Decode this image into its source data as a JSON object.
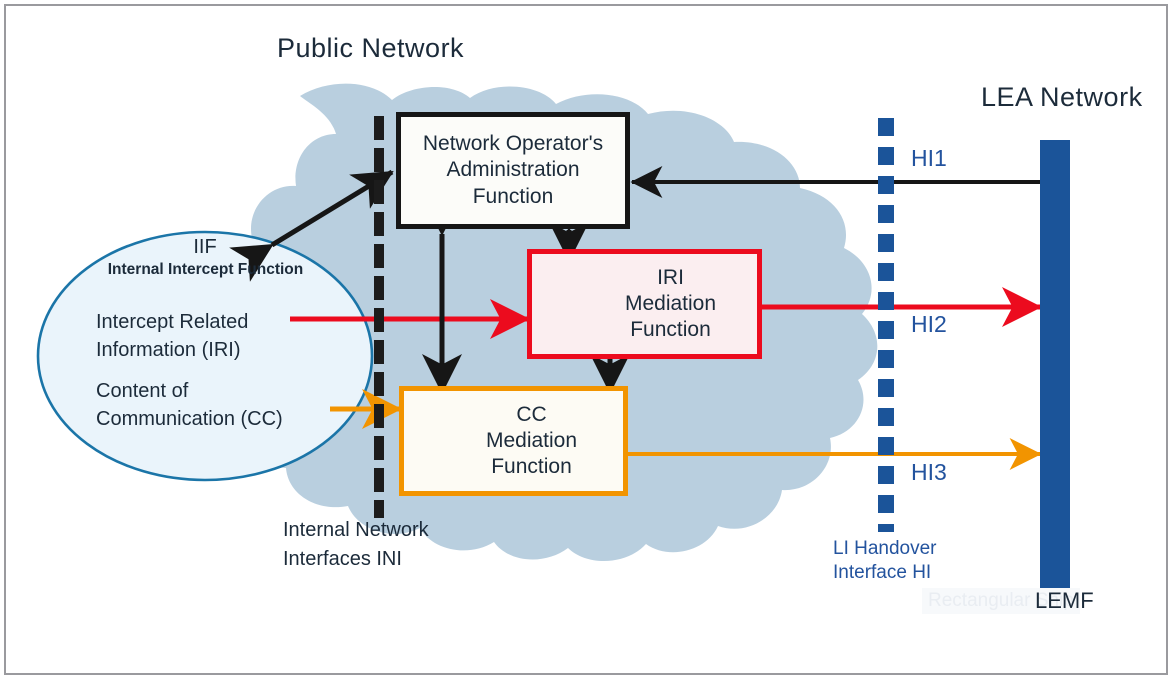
{
  "diagram": {
    "titles": {
      "public_network": "Public Network",
      "lea_network": "LEA Network"
    },
    "cloud": {
      "name": "public-network-cloud",
      "color": "#b9cfdf"
    },
    "ellipse": {
      "name": "iif-ellipse",
      "acronym": "IIF",
      "expansion": "Internal Intercept Function",
      "line1": "Intercept Related",
      "line2": "Information (IRI)",
      "line3": "Content of",
      "line4": "Communication (CC)",
      "fill": "#eaf4fb",
      "stroke": "#1b75a8"
    },
    "boxes": [
      {
        "id": "noaf",
        "line1": "Network Operator's",
        "line2": "Administration",
        "line3": "Function",
        "border": "#161616",
        "fill": "#fcfcf9"
      },
      {
        "id": "iri-mediation",
        "line1": "IRI",
        "line2": "Mediation",
        "line3": "Function",
        "border": "#ec0b1e",
        "fill": "#fbeef0"
      },
      {
        "id": "cc-mediation",
        "line1": "CC",
        "line2": "Mediation",
        "line3": "Function",
        "border": "#f29400",
        "fill": "#fdfbf4"
      }
    ],
    "interfaces": {
      "ini_line1": "Internal Network",
      "ini_line2": "Interfaces INI",
      "hi1": "HI1",
      "hi2": "HI2",
      "hi3": "HI3",
      "hi_caption_line1": "LI Handover",
      "hi_caption_line2": "Interface HI",
      "hi_color": "#23539e"
    },
    "lemf": {
      "label": "LEMF",
      "bar_color": "#1b5499"
    },
    "flows": [
      {
        "name": "iif-to-noaf-admin",
        "color": "#161616",
        "style": "double-arrow-diagonal"
      },
      {
        "name": "noaf-to-lemf-hi1",
        "color": "#161616",
        "style": "single-arrow-left"
      },
      {
        "name": "iif-iri-to-iri-mediation",
        "color": "#ec0b1e",
        "style": "single-arrow-right"
      },
      {
        "name": "iri-mediation-to-lemf-hi2",
        "color": "#ec0b1e",
        "style": "single-arrow-right"
      },
      {
        "name": "iif-cc-to-cc-mediation",
        "color": "#f29400",
        "style": "single-arrow-right"
      },
      {
        "name": "cc-mediation-to-lemf-hi3",
        "color": "#f29400",
        "style": "single-arrow-right"
      },
      {
        "name": "noaf-to-cc-mediation",
        "color": "#161616",
        "style": "double-arrow-vertical"
      },
      {
        "name": "noaf-to-iri-mediation",
        "color": "#161616",
        "style": "double-arrow-vertical"
      },
      {
        "name": "iri-to-cc-mediation",
        "color": "#161616",
        "style": "double-arrow-vertical"
      }
    ],
    "watermark": {
      "snip_text": "Rectangular Snip"
    }
  }
}
